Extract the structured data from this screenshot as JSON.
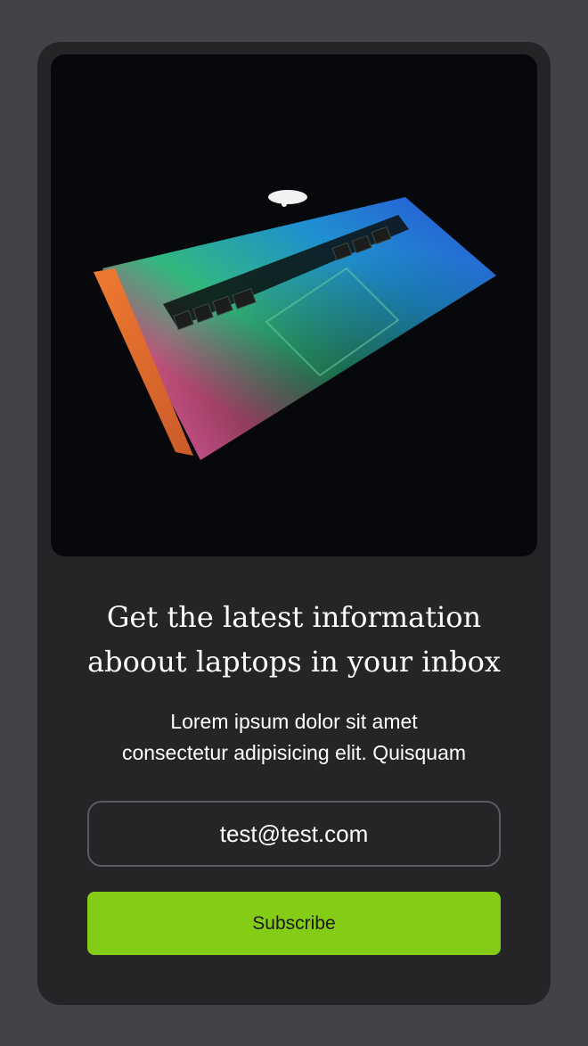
{
  "newsletter": {
    "title_line1": "Get the latest information",
    "title_line2": "aboout laptops in your inbox",
    "description_line1": "Lorem ipsum dolor sit amet",
    "description_line2": "consectetur adipisicing elit. Quisquam",
    "email_value": "test@test.com",
    "subscribe_label": "Subscribe"
  },
  "colors": {
    "page_background": "#434249",
    "card_background": "#252527",
    "accent": "#84cc16"
  },
  "hero_image": {
    "icon": "laptop-image"
  }
}
